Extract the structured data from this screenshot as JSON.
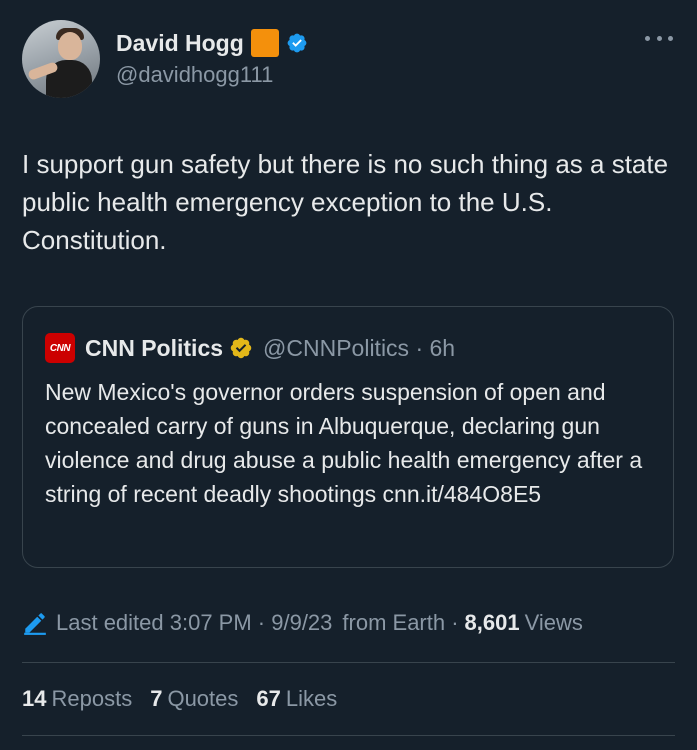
{
  "author": {
    "display_name": "David Hogg",
    "handle": "@davidhogg111",
    "emoji_color": "#f4900c",
    "verified_color": "#1d9bf0"
  },
  "tweet": {
    "text": "I support gun safety but there is no such thing as a state public health emergency exception to the U.S. Constitution."
  },
  "quoted": {
    "logo_text": "CNN",
    "name": "CNN Politics",
    "handle_time": "@CNNPolitics · 6h",
    "badge_color": "#e2b719",
    "text": "New Mexico's governor orders suspension of open and concealed carry of guns in Albuquerque, declaring gun violence and drug abuse a public health emergency after a string of recent deadly shootings cnn.it/484O8E5"
  },
  "meta": {
    "edited": "Last edited 3:07 PM · 9/9/23",
    "source": "from Earth ·",
    "views_count": "8,601",
    "views_label": "Views"
  },
  "stats": {
    "reposts_count": "14",
    "reposts_label": "Reposts",
    "quotes_count": "7",
    "quotes_label": "Quotes",
    "likes_count": "67",
    "likes_label": "Likes"
  },
  "icons": {
    "more": "more-icon",
    "edit": "pencil-icon",
    "verified": "verified-badge-icon",
    "affiliate": "gold-badge-icon"
  }
}
